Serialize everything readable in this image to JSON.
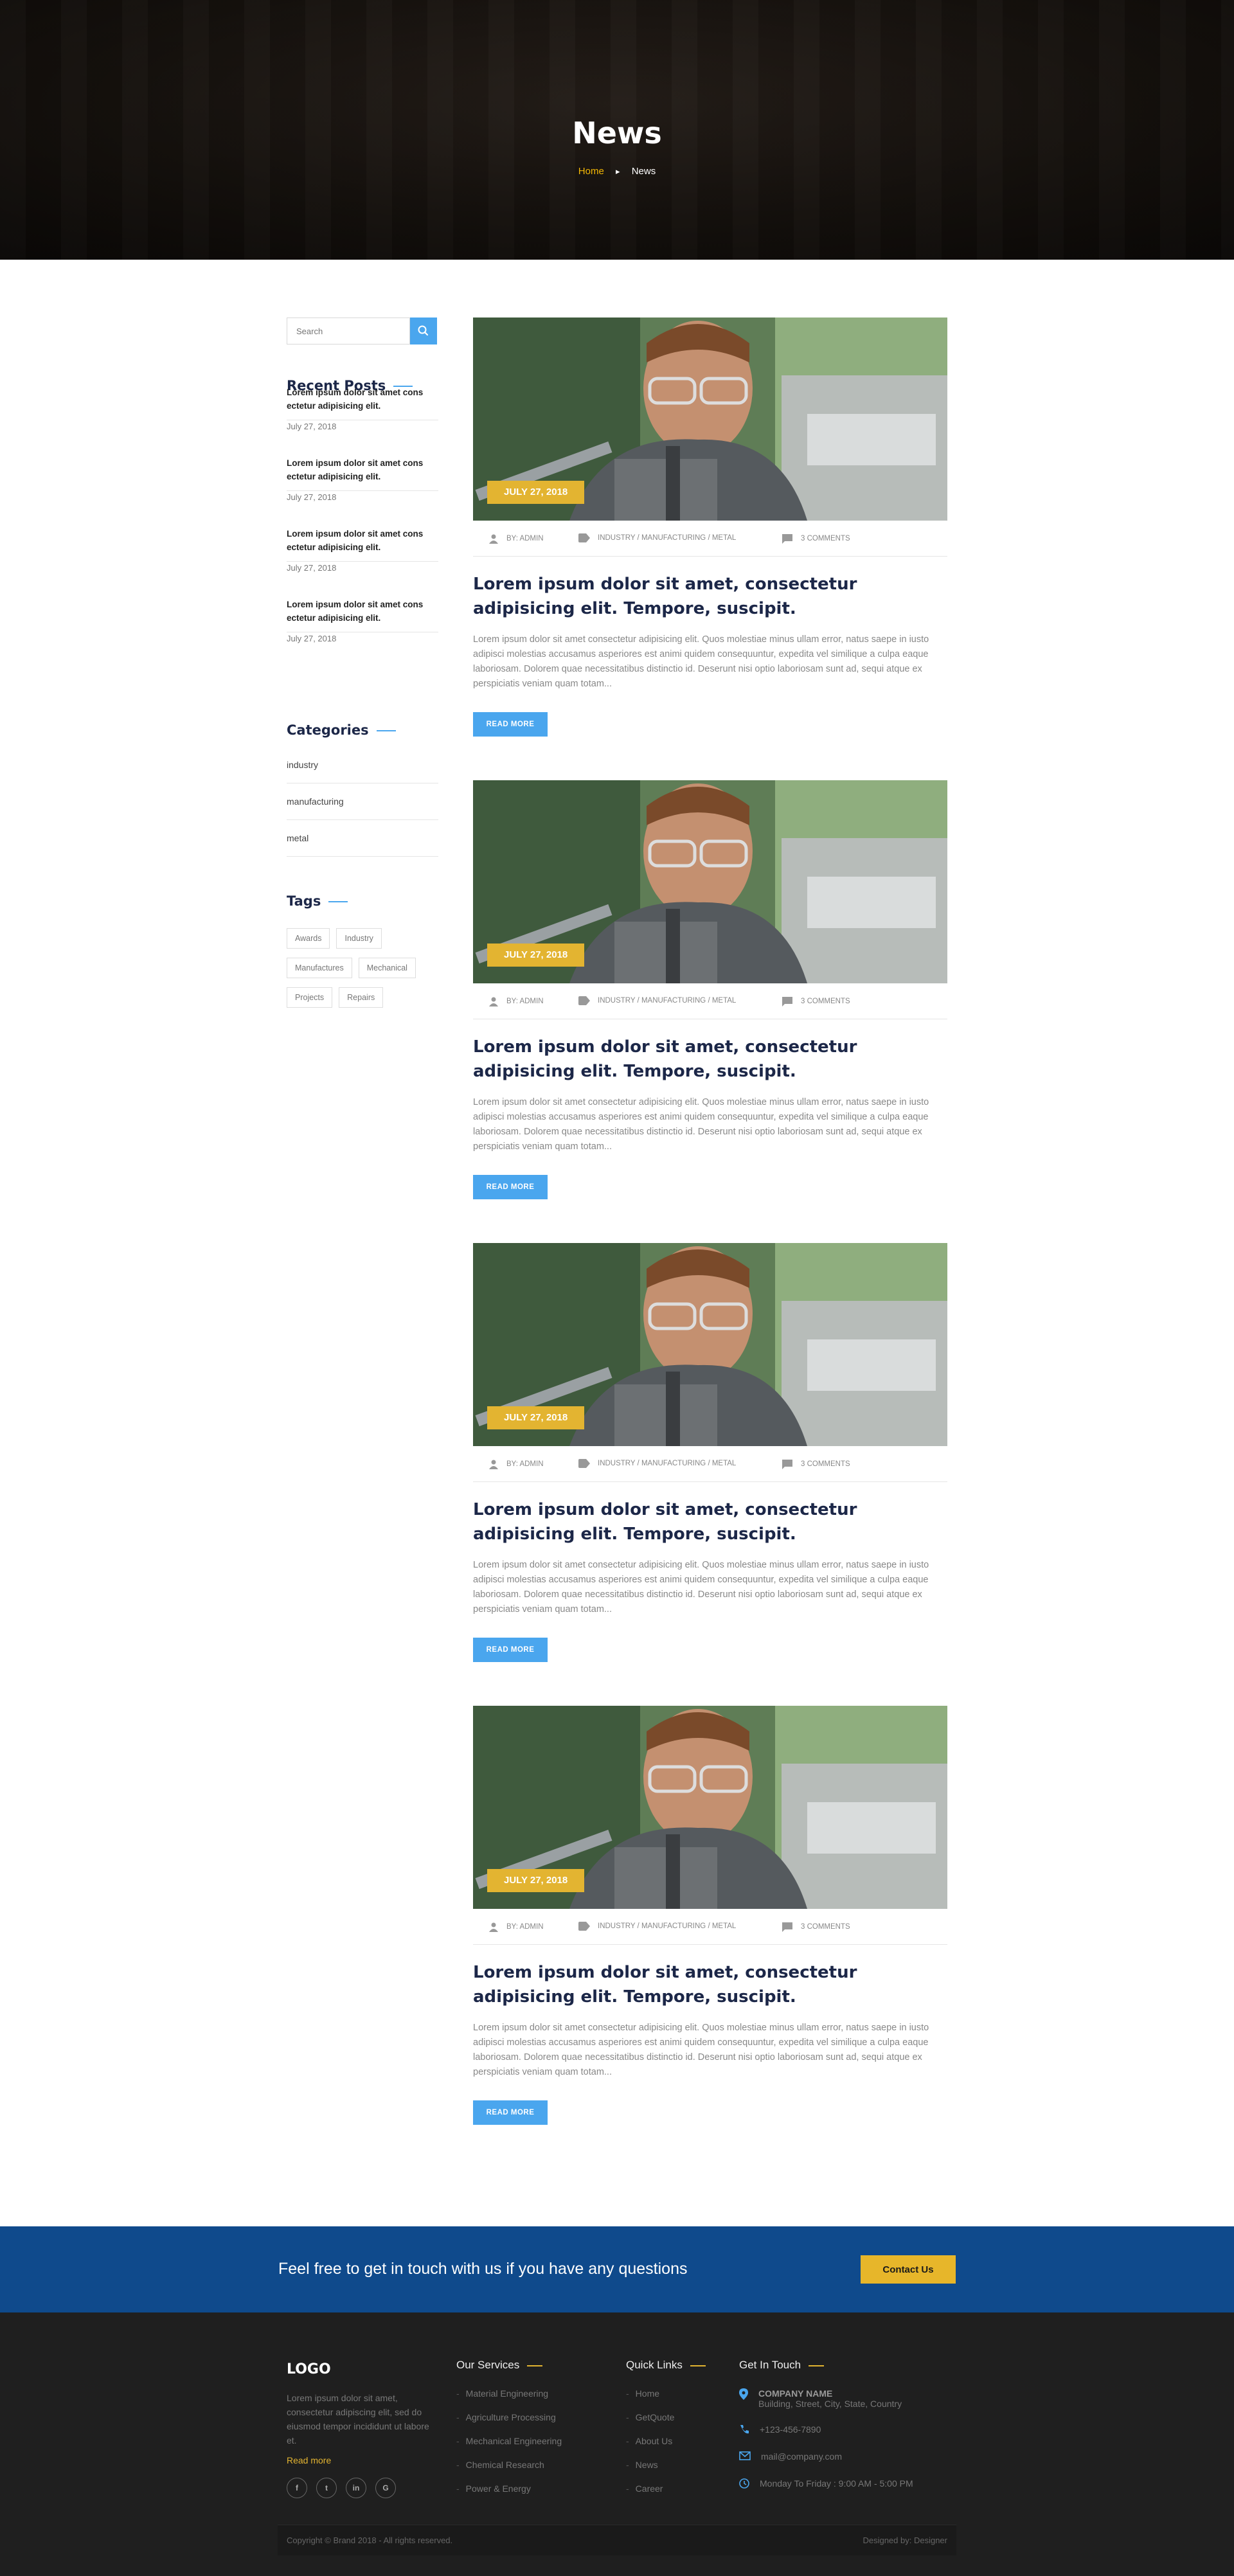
{
  "hero": {
    "title": "News",
    "breadcrumb_home": "Home",
    "breadcrumb_current": "News"
  },
  "sidebar": {
    "search_placeholder": "Search",
    "recent_title": "Recent Posts",
    "recent_posts": [
      {
        "title": "Lorem ipsum dolor sit amet cons ectetur adipisicing elit.",
        "date": "July 27, 2018"
      },
      {
        "title": "Lorem ipsum dolor sit amet cons ectetur adipisicing elit.",
        "date": "July 27, 2018"
      },
      {
        "title": "Lorem ipsum dolor sit amet cons ectetur adipisicing elit.",
        "date": "July 27, 2018"
      },
      {
        "title": "Lorem ipsum dolor sit amet cons ectetur adipisicing elit.",
        "date": "July 27, 2018"
      }
    ],
    "categories_title": "Categories",
    "categories": [
      "industry",
      "manufacturing",
      "metal"
    ],
    "tags_title": "Tags",
    "tags": [
      "Awards",
      "Industry",
      "Manufactures",
      "Mechanical",
      "Projects",
      "Repairs"
    ]
  },
  "posts": [
    {
      "date": "JULY 27, 2018",
      "author": "BY: ADMIN",
      "categories": "INDUSTRY / MANUFACTURING / METAL",
      "comments": "3 COMMENTS",
      "title": "Lorem ipsum dolor sit amet, consectetur adipisicing elit. Tempore, suscipit.",
      "excerpt": "Lorem ipsum dolor sit amet consectetur adipisicing elit. Quos molestiae minus ullam error, natus saepe in iusto adipisci molestias accusamus asperiores est animi quidem consequuntur, expedita vel similique a culpa eaque laboriosam. Dolorem quae necessitatibus distinctio id. Deserunt nisi optio laboriosam sunt ad, sequi atque ex perspiciatis veniam quam totam...",
      "button": "READ MORE"
    },
    {
      "date": "JULY 27, 2018",
      "author": "BY: ADMIN",
      "categories": "INDUSTRY / MANUFACTURING / METAL",
      "comments": "3 COMMENTS",
      "title": "Lorem ipsum dolor sit amet, consectetur adipisicing elit. Tempore, suscipit.",
      "excerpt": "Lorem ipsum dolor sit amet consectetur adipisicing elit. Quos molestiae minus ullam error, natus saepe in iusto adipisci molestias accusamus asperiores est animi quidem consequuntur, expedita vel similique a culpa eaque laboriosam. Dolorem quae necessitatibus distinctio id. Deserunt nisi optio laboriosam sunt ad, sequi atque ex perspiciatis veniam quam totam...",
      "button": "READ MORE"
    },
    {
      "date": "JULY 27, 2018",
      "author": "BY: ADMIN",
      "categories": "INDUSTRY / MANUFACTURING / METAL",
      "comments": "3 COMMENTS",
      "title": "Lorem ipsum dolor sit amet, consectetur adipisicing elit. Tempore, suscipit.",
      "excerpt": "Lorem ipsum dolor sit amet consectetur adipisicing elit. Quos molestiae minus ullam error, natus saepe in iusto adipisci molestias accusamus asperiores est animi quidem consequuntur, expedita vel similique a culpa eaque laboriosam. Dolorem quae necessitatibus distinctio id. Deserunt nisi optio laboriosam sunt ad, sequi atque ex perspiciatis veniam quam totam...",
      "button": "READ MORE"
    },
    {
      "date": "JULY 27, 2018",
      "author": "BY: ADMIN",
      "categories": "INDUSTRY / MANUFACTURING / METAL",
      "comments": "3 COMMENTS",
      "title": "Lorem ipsum dolor sit amet, consectetur adipisicing elit. Tempore, suscipit.",
      "excerpt": "Lorem ipsum dolor sit amet consectetur adipisicing elit. Quos molestiae minus ullam error, natus saepe in iusto adipisci molestias accusamus asperiores est animi quidem consequuntur, expedita vel similique a culpa eaque laboriosam. Dolorem quae necessitatibus distinctio id. Deserunt nisi optio laboriosam sunt ad, sequi atque ex perspiciatis veniam quam totam...",
      "button": "READ MORE"
    }
  ],
  "cta": {
    "text": "Feel free to get in touch with us if you have any questions",
    "button": "Contact Us"
  },
  "footer": {
    "logo": "LOGO",
    "about": "Lorem ipsum dolor sit amet, consectetur adipiscing elit, sed do eiusmod tempor incididunt ut labore et.",
    "read_more": "Read more",
    "socials": [
      "f",
      "t",
      "in",
      "G"
    ],
    "services_title": "Our Services",
    "services": [
      "Material Engineering",
      "Agriculture Processing",
      "Mechanical Engineering",
      "Chemical Research",
      "Power & Energy"
    ],
    "links_title": "Quick Links",
    "links": [
      "Home",
      "GetQuote",
      "About Us",
      "News",
      "Career"
    ],
    "contact_title": "Get In Touch",
    "company_name": "COMPANY NAME",
    "address": "Building, Street, City, State, Country",
    "phone": "+123-456-7890",
    "email": "mail@company.com",
    "hours": "Monday To Friday : 9:00 AM - 5:00 PM",
    "copyright": "Copyright © Brand 2018 - All rights reserved.",
    "designed_by": "Designed by: Designer"
  },
  "colors": {
    "accent_blue": "#4aa6ee",
    "accent_gold": "#e3b431",
    "cta_bg": "#0f4a8c",
    "footer_bg": "#1f1f1f",
    "heading": "#1c2748"
  }
}
